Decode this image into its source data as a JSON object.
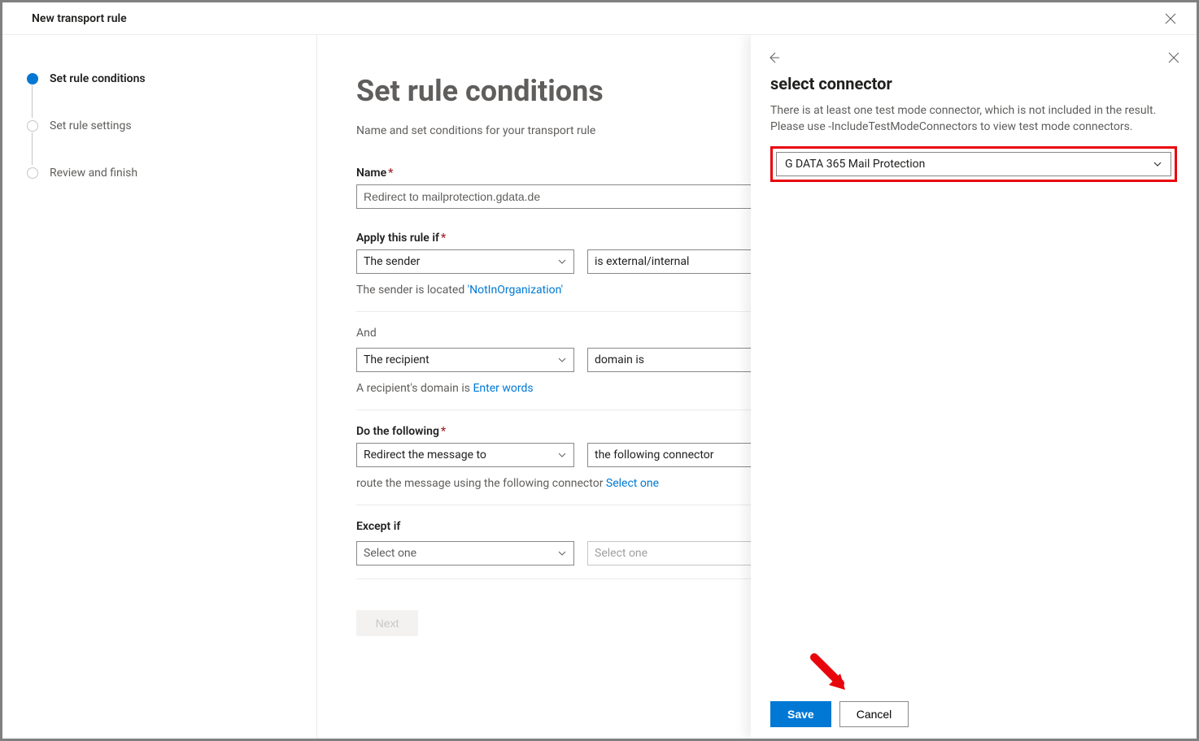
{
  "window": {
    "title": "New transport rule"
  },
  "steps": [
    {
      "label": "Set rule conditions",
      "active": true
    },
    {
      "label": "Set rule settings",
      "active": false
    },
    {
      "label": "Review and finish",
      "active": false
    }
  ],
  "main": {
    "heading": "Set rule conditions",
    "description": "Name and set conditions for your transport rule",
    "name_label": "Name",
    "name_value": "Redirect to mailprotection.gdata.de",
    "apply_if_label": "Apply this rule if",
    "apply_if_dd1": "The sender",
    "apply_if_dd2": "is external/internal",
    "apply_if_helper_prefix": "The sender is located ",
    "apply_if_helper_link": "'NotInOrganization'",
    "and_label": "And",
    "and_dd1": "The recipient",
    "and_dd2": "domain is",
    "and_helper_prefix": "A recipient's domain is ",
    "and_helper_link": "Enter words",
    "do_label": "Do the following",
    "do_dd1": "Redirect the message to",
    "do_dd2": "the following connector",
    "do_helper_prefix": "route the message using the following connector ",
    "do_helper_link": "Select one",
    "except_label": "Except if",
    "except_dd1": "Select one",
    "except_dd2": "Select one",
    "next_label": "Next"
  },
  "flyout": {
    "title": "select connector",
    "description": "There is at least one test mode connector, which is not included in the result. Please use -IncludeTestModeConnectors to view test mode connectors.",
    "dropdown_value": "G DATA 365 Mail Protection",
    "save_label": "Save",
    "cancel_label": "Cancel"
  }
}
